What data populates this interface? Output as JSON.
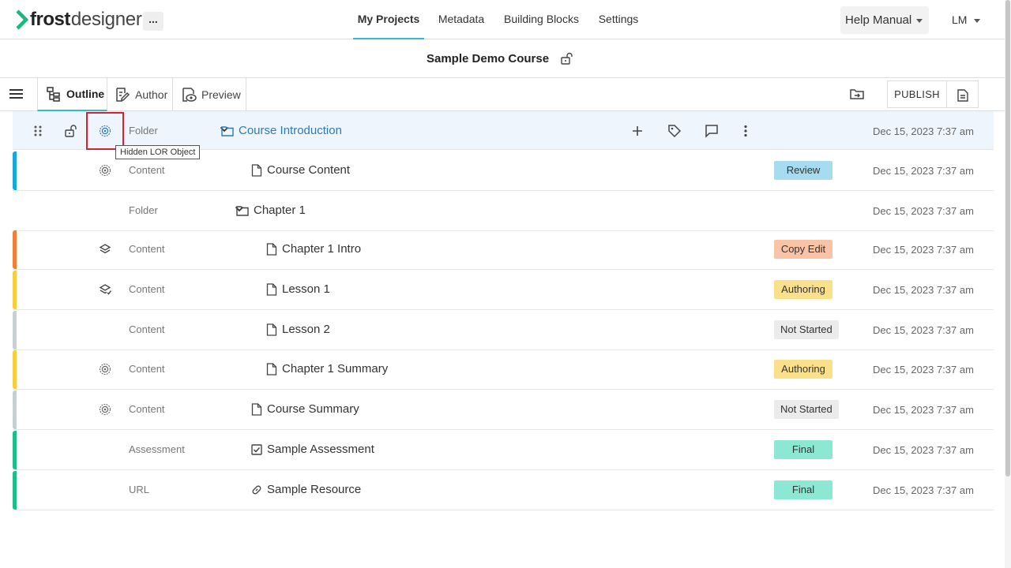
{
  "app": {
    "logo_bold": "frost",
    "logo_light": "designer",
    "more_label": "...",
    "brand_color": "#1ab87a"
  },
  "nav": {
    "items": [
      "My Projects",
      "Metadata",
      "Building Blocks",
      "Settings"
    ],
    "active": "My Projects",
    "help_label": "Help Manual",
    "user_initials": "LM"
  },
  "course": {
    "title": "Sample Demo Course"
  },
  "toolbar": {
    "tabs": [
      "Outline",
      "Author",
      "Preview"
    ],
    "active_tab": "Outline",
    "publish_label": "PUBLISH"
  },
  "tooltip": {
    "text": "Hidden LOR Object"
  },
  "colors": {
    "accent": "#35b8d6",
    "link": "#2e79b5",
    "highlight": "#d9202e"
  },
  "rows": [
    {
      "type": "Folder",
      "name": "Course Introduction",
      "icon": "folder-icon",
      "expanded": true,
      "status": "",
      "status_color": "",
      "date": "Dec 15, 2023 7:37 am",
      "bar_color": "",
      "lor_icon": "hidden-lor-icon"
    },
    {
      "type": "Content",
      "name": "Course Content",
      "icon": "document-icon",
      "status": "Review",
      "status_color": "#a7dcf0",
      "date": "Dec 15, 2023 7:37 am",
      "bar_color": "#1aa7e0",
      "lor_icon": "hidden-lor-icon"
    },
    {
      "type": "Folder",
      "name": "Chapter 1",
      "icon": "folder-icon",
      "expanded": true,
      "status": "",
      "status_color": "",
      "date": "Dec 15, 2023 7:37 am",
      "bar_color": "",
      "lor_icon": ""
    },
    {
      "type": "Content",
      "name": "Chapter 1 Intro",
      "icon": "document-icon",
      "status": "Copy Edit",
      "status_color": "#f9c3a5",
      "date": "Dec 15, 2023 7:37 am",
      "bar_color": "#f07f35",
      "lor_icon": "layers-icon"
    },
    {
      "type": "Content",
      "name": "Lesson 1",
      "icon": "document-icon",
      "status": "Authoring",
      "status_color": "#fbe08c",
      "date": "Dec 15, 2023 7:37 am",
      "bar_color": "#f8cd3c",
      "lor_icon": "layers-check-icon"
    },
    {
      "type": "Content",
      "name": "Lesson 2",
      "icon": "document-icon",
      "status": "Not Started",
      "status_color": "#ebebeb",
      "date": "Dec 15, 2023 7:37 am",
      "bar_color": "#c7cfd3",
      "lor_icon": ""
    },
    {
      "type": "Content",
      "name": "Chapter 1 Summary",
      "icon": "document-icon",
      "status": "Authoring",
      "status_color": "#fbe08c",
      "date": "Dec 15, 2023 7:37 am",
      "bar_color": "#f8cd3c",
      "lor_icon": "hidden-lor-icon"
    },
    {
      "type": "Content",
      "name": "Course Summary",
      "icon": "document-icon",
      "status": "Not Started",
      "status_color": "#ebebeb",
      "date": "Dec 15, 2023 7:37 am",
      "bar_color": "#c7cfd3",
      "lor_icon": "hidden-lor-icon"
    },
    {
      "type": "Assessment",
      "name": "Sample Assessment",
      "icon": "checkbox-icon",
      "status": "Final",
      "status_color": "#8ce8d3",
      "date": "Dec 15, 2023 7:37 am",
      "bar_color": "#1ebd8c",
      "lor_icon": ""
    },
    {
      "type": "URL",
      "name": "Sample Resource",
      "icon": "link-icon",
      "status": "Final",
      "status_color": "#8ce8d3",
      "date": "Dec 15, 2023 7:37 am",
      "bar_color": "#1ebd8c",
      "lor_icon": ""
    }
  ]
}
